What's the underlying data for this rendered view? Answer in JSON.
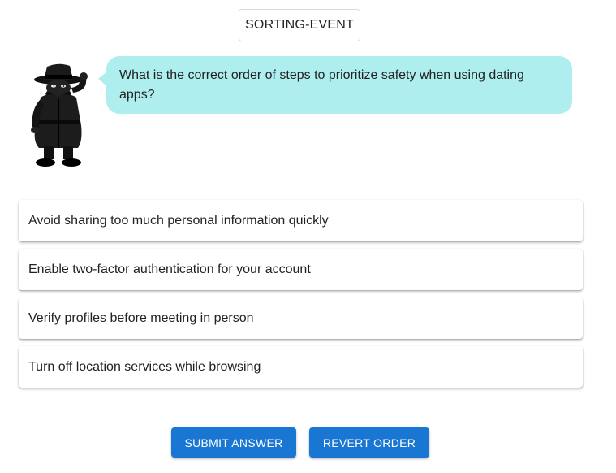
{
  "header": {
    "event_label": "SORTING-EVENT"
  },
  "character": {
    "icon": "spy-detective-icon"
  },
  "question": {
    "text": "What is the correct order of steps to prioritize safety when using dating apps?",
    "bubble_color": "#afeeee"
  },
  "options": [
    {
      "label": "Avoid sharing too much personal information quickly"
    },
    {
      "label": "Enable two-factor authentication for your account"
    },
    {
      "label": "Verify profiles before meeting in person"
    },
    {
      "label": "Turn off location services while browsing"
    }
  ],
  "actions": {
    "submit_label": "SUBMIT ANSWER",
    "revert_label": "REVERT ORDER",
    "button_color": "#1976d2"
  }
}
